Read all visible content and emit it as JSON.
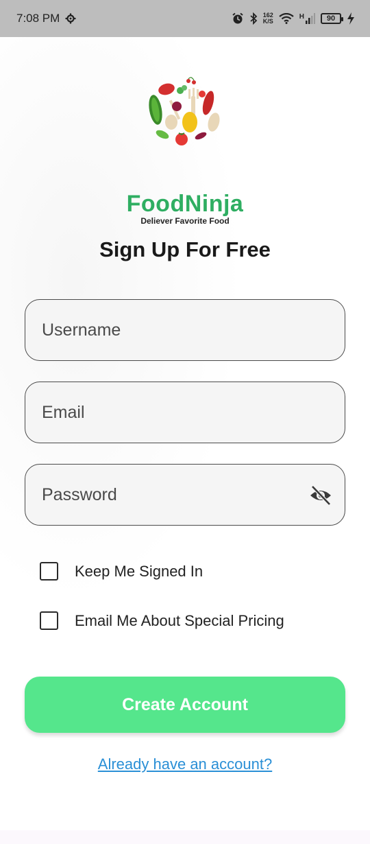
{
  "status_bar": {
    "time": "7:08 PM",
    "net_speed_value": "162",
    "net_speed_unit": "K/S",
    "signal_type": "H",
    "battery": "90"
  },
  "brand": {
    "name": "FoodNinja",
    "tagline": "Deliever Favorite Food"
  },
  "form": {
    "title": "Sign Up For Free",
    "username_placeholder": "Username",
    "email_placeholder": "Email",
    "password_placeholder": "Password",
    "keep_signed_in": "Keep Me Signed In",
    "email_pricing": "Email Me About Special Pricing",
    "create_button": "Create Account",
    "login_link": "Already have an account?"
  },
  "icons": {
    "settings": "gear-icon",
    "alarm": "alarm-icon",
    "bluetooth": "bluetooth-icon",
    "wifi": "wifi-icon",
    "signal": "signal-icon",
    "battery": "battery-icon",
    "charging": "charging-icon",
    "password_toggle": "eye-off-icon"
  },
  "colors": {
    "brand_green": "#2fae62",
    "button_green": "#55e68c",
    "link_blue": "#2a8fd6",
    "status_bar": "#bdbdbd"
  }
}
